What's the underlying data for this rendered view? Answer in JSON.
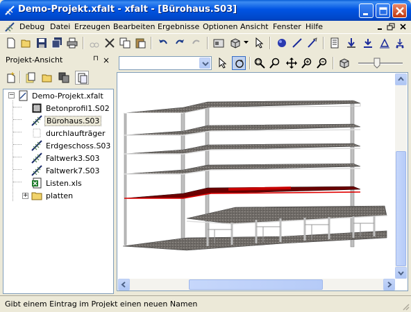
{
  "window": {
    "title": "Demo-Projekt.xfalt - xfalt - [Bürohaus.S03]",
    "buttons": [
      "minimize",
      "maximize",
      "close"
    ]
  },
  "menu": {
    "items": [
      "Debug",
      "Datei",
      "Erzeugen",
      "Bearbeiten",
      "Ergebnisse",
      "Optionen",
      "Ansicht",
      "Fenster",
      "Hilfe"
    ]
  },
  "toolbar": {
    "icons": [
      "new-icon",
      "open-icon",
      "save-icon",
      "save-all-icon",
      "print-icon",
      "cut-disabled-icon",
      "delete-icon",
      "copy-icon",
      "paste-icon",
      "undo-icon",
      "redo-icon",
      "redo-disabled-icon",
      "properties-icon",
      "3d-view-icon",
      "pointer-icon",
      "sphere-icon",
      "line-icon",
      "dimension-icon",
      "list-icon",
      "load-icon",
      "support-icon",
      "node-icon"
    ]
  },
  "project_panel": {
    "title": "Projekt-Ansicht",
    "close_label": "×",
    "tree": [
      {
        "label": "Demo-Projekt.xfalt",
        "icon": "project-icon",
        "level": 0,
        "expanded": true
      },
      {
        "label": "Betonprofil1.S02",
        "icon": "profile-icon",
        "level": 1
      },
      {
        "label": "Bürohaus.S03",
        "icon": "structure-icon",
        "level": 1,
        "selected": true
      },
      {
        "label": "durchlaufträger",
        "icon": "blank-doc-icon",
        "level": 1
      },
      {
        "label": "Erdgeschoss.S03",
        "icon": "structure-icon",
        "level": 1
      },
      {
        "label": "Faltwerk3.S03",
        "icon": "structure-icon",
        "level": 1
      },
      {
        "label": "Faltwerk7.S03",
        "icon": "structure-icon",
        "level": 1
      },
      {
        "label": "Listen.xls",
        "icon": "excel-icon",
        "level": 1
      },
      {
        "label": "platten",
        "icon": "folder-icon",
        "level": 1,
        "expanded": false
      }
    ]
  },
  "view_toolbar": {
    "combo_value": "",
    "icons": [
      "select-icon",
      "rotate-icon",
      "zoom-window-icon",
      "zoom-icon",
      "pan-icon",
      "zoom-in-icon",
      "zoom-out-icon",
      "render-icon"
    ]
  },
  "status": {
    "text": "Gibt einem Eintrag im Projekt einen neuen Namen"
  },
  "colors": {
    "titlebar": "#0054e3",
    "highlighted_slab": "#6b0000",
    "slab": "#6e6a66"
  }
}
